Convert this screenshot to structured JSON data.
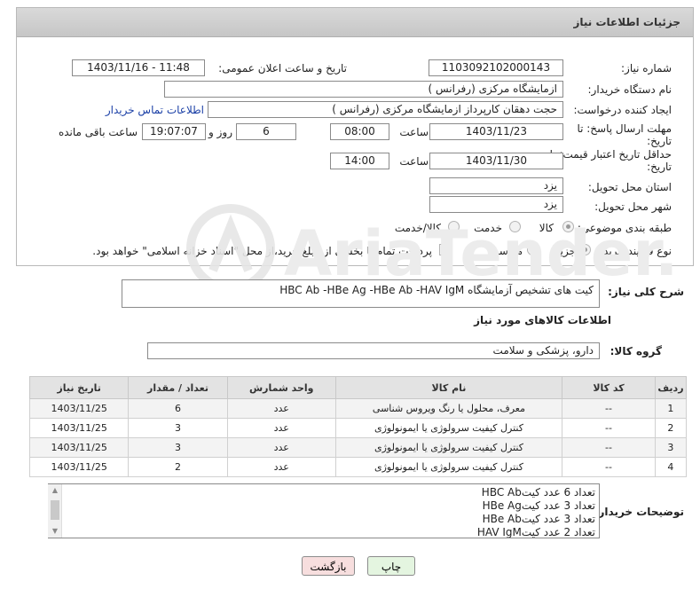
{
  "header": {
    "title": "جزئیات اطلاعات نیاز"
  },
  "form": {
    "need_number_label": "شماره نیاز:",
    "need_number": "1103092102000143",
    "announce_label": "تاریخ و ساعت اعلان عمومی:",
    "announce_value": "1403/11/16 - 11:48",
    "buyer_org_label": "نام دستگاه خریدار:",
    "buyer_org": "ازمایشگاه مرکزی (رفرانس )",
    "creator_label": "ایجاد کننده درخواست:",
    "creator": "حجت دهقان کارپرداز ازمایشگاه مرکزی (رفرانس )",
    "contact_link": "اطلاعات تماس خریدار",
    "deadline_label": "مهلت ارسال پاسخ: تا",
    "deadline_label2": "تاریخ:",
    "deadline_date": "1403/11/23",
    "time_label": "ساعت",
    "deadline_time": "08:00",
    "days_value": "6",
    "days_label": "روز و",
    "remaining_time": "19:07:07",
    "remaining_label": "ساعت باقی مانده",
    "validity_label": "حداقل تاریخ اعتبار قیمت: تا",
    "validity_label2": "تاریخ:",
    "validity_date": "1403/11/30",
    "validity_time": "14:00",
    "province_label": "استان محل تحویل:",
    "province": "یزد",
    "city_label": "شهر محل تحویل:",
    "city": "یزد",
    "category_label": "طبقه بندی موضوعی:",
    "category_options": [
      "کالا",
      "خدمت",
      "کالا/خدمت"
    ],
    "purchase_type_label": "نوع فرآیند خرید :",
    "purchase_options": [
      "جزیی",
      "متوسط"
    ],
    "purchase_note": "پرداخت تمام یا بخشی از مبلغ خرید،از محل \"اسناد خزانه اسلامی\" خواهد بود."
  },
  "description": {
    "label": "شرح کلی نیاز:",
    "value": "کیت های تشخیص آزمایشگاه HBC Ab -HBe Ag -HBe Ab -HAV IgM"
  },
  "goods": {
    "section_title": "اطلاعات کالاهای مورد نیاز",
    "group_label": "گروه کالا:",
    "group_value": "دارو، پزشکی و سلامت",
    "columns": [
      "ردیف",
      "کد کالا",
      "نام کالا",
      "واحد شمارش",
      "تعداد / مقدار",
      "تاریخ نیاز"
    ],
    "rows": [
      {
        "idx": "1",
        "code": "--",
        "name": "معرف، محلول یا رنگ ویروس شناسی",
        "unit": "عدد",
        "qty": "6",
        "date": "1403/11/25"
      },
      {
        "idx": "2",
        "code": "--",
        "name": "کنترل کیفیت سرولوژی یا ایمونولوژی",
        "unit": "عدد",
        "qty": "3",
        "date": "1403/11/25"
      },
      {
        "idx": "3",
        "code": "--",
        "name": "کنترل کیفیت سرولوژی یا ایمونولوژی",
        "unit": "عدد",
        "qty": "3",
        "date": "1403/11/25"
      },
      {
        "idx": "4",
        "code": "--",
        "name": "کنترل کیفیت سرولوژی یا ایمونولوژی",
        "unit": "عدد",
        "qty": "2",
        "date": "1403/11/25"
      }
    ]
  },
  "buyer_notes": {
    "label": "توضیحات خریدار:",
    "lines": [
      "تعداد 6 عدد کیتHBC Ab",
      "تعداد 3 عدد کیتHBe Ag",
      "تعداد 3 عدد کیتHBe Ab",
      "تعداد 2 عدد کیتHAV IgM"
    ]
  },
  "buttons": {
    "print": "چاپ",
    "back": "بازگشت"
  },
  "colors": {
    "header_bg": "#cfcfcf",
    "link": "#1a3fa6",
    "back_btn": "#f7dede",
    "print_btn": "#e4f5e0"
  }
}
